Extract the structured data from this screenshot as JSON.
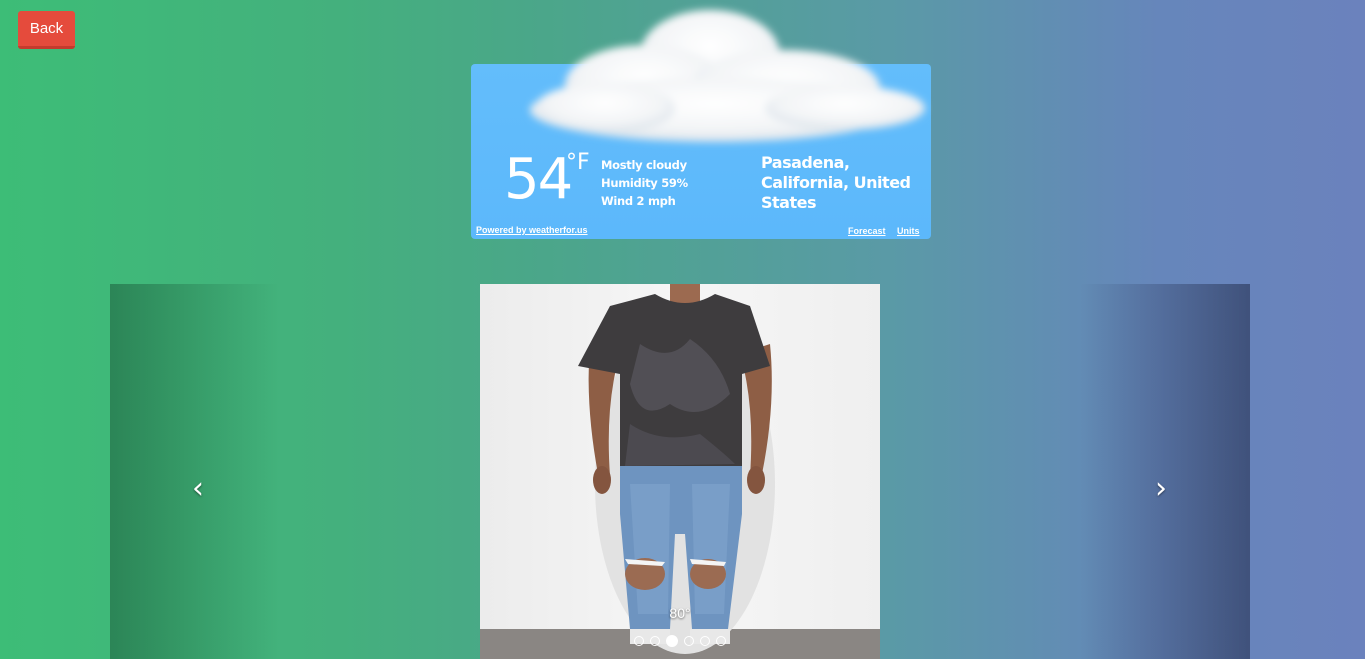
{
  "back_button": {
    "label": "Back"
  },
  "weather": {
    "temperature": "54",
    "unit": "°F",
    "condition": "Mostly cloudy",
    "humidity": "Humidity 59%",
    "wind": "Wind 2 mph",
    "location": "Pasadena, California, United States",
    "powered_by": "Powered by weatherfor.us",
    "forecast_link": "Forecast",
    "units_link": "Units"
  },
  "carousel": {
    "caption": "80°",
    "slide_count": 6,
    "active_index": 2,
    "prev_icon": "chevron-left-icon",
    "next_icon": "chevron-right-icon"
  },
  "colors": {
    "back_button": "#e54b3c",
    "weather_bg": "#5cb8fb",
    "bg_left": "#3dbd77",
    "bg_right": "#6b82bd"
  }
}
